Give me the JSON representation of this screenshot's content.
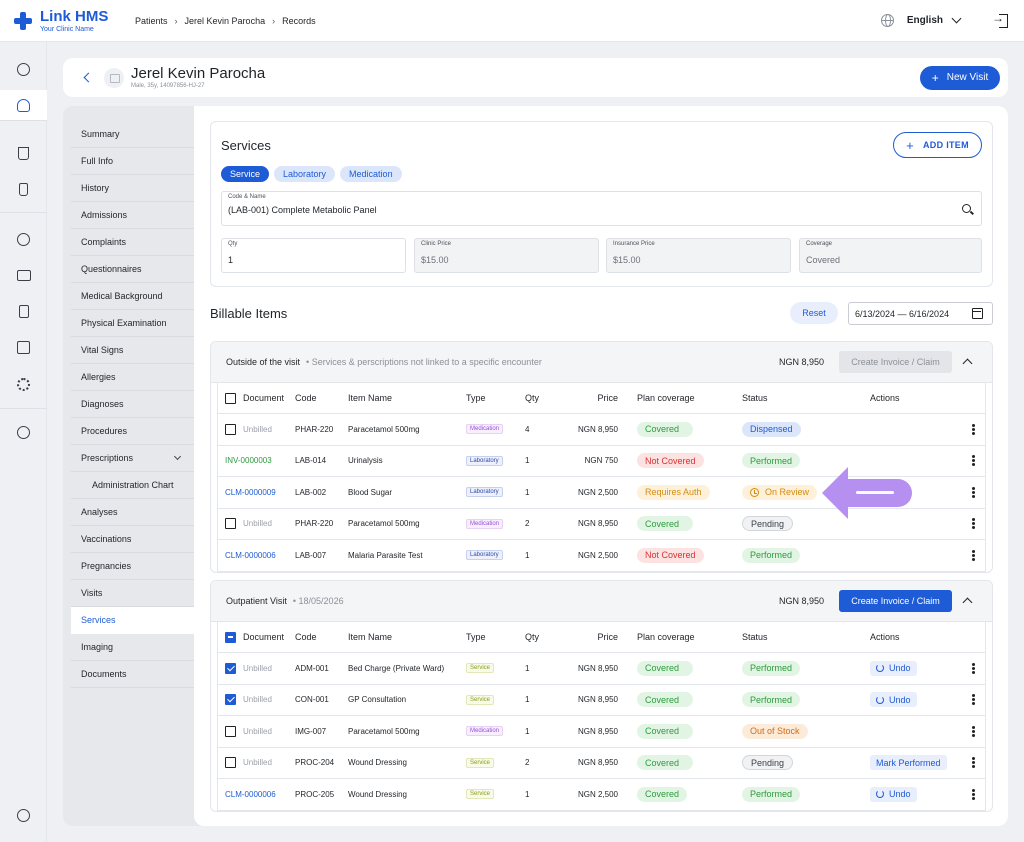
{
  "app": {
    "logo_name": "Link HMS",
    "logo_sub": "Your Clinic Name"
  },
  "breadcrumb": [
    "Patients",
    "Jerel Kevin Parocha",
    "Records"
  ],
  "language": "English",
  "patient": {
    "name": "Jerel Kevin Parocha",
    "meta": "Male, 35y, 14097856-HJ-27"
  },
  "new_visit_label": "New Visit",
  "subnav": [
    {
      "label": "Summary"
    },
    {
      "label": "Full Info"
    },
    {
      "label": "History"
    },
    {
      "label": "Admissions"
    },
    {
      "label": "Complaints"
    },
    {
      "label": "Questionnaires"
    },
    {
      "label": "Medical Background"
    },
    {
      "label": "Physical Examination"
    },
    {
      "label": "Vital Signs"
    },
    {
      "label": "Allergies"
    },
    {
      "label": "Diagnoses"
    },
    {
      "label": "Procedures"
    },
    {
      "label": "Prescriptions"
    },
    {
      "label": "Administration Chart"
    },
    {
      "label": "Analyses"
    },
    {
      "label": "Vaccinations"
    },
    {
      "label": "Pregnancies"
    },
    {
      "label": "Visits"
    },
    {
      "label": "Services"
    },
    {
      "label": "Imaging"
    },
    {
      "label": "Documents"
    }
  ],
  "services": {
    "title": "Services",
    "add_item_label": "ADD ITEM",
    "tabs": [
      "Service",
      "Laboratory",
      "Medication"
    ],
    "code_name": {
      "label": "Code & Name",
      "value": "(LAB-001) Complete Metabolic Panel"
    },
    "qty": {
      "label": "Qty",
      "value": "1"
    },
    "clinic_price": {
      "label": "Clinic Price",
      "value": "$15.00"
    },
    "insurance_price": {
      "label": "Insurance Price",
      "value": "$15.00"
    },
    "coverage": {
      "label": "Coverage",
      "value": "Covered"
    }
  },
  "billable": {
    "title": "Billable Items",
    "reset_label": "Reset",
    "date_range": "6/13/2024 — 6/16/2024"
  },
  "columns": {
    "document": "Document",
    "code": "Code",
    "item_name": "Item Name",
    "type": "Type",
    "qty": "Qty",
    "price": "Price",
    "plan": "Plan coverage",
    "status": "Status",
    "actions": "Actions"
  },
  "groups": [
    {
      "title": "Outside of the visit",
      "subtitle": "Services & perscriptions not linked to a specific encounter",
      "total": "NGN 8,950",
      "invoice_label": "Create Invoice / Claim",
      "rows": [
        {
          "doc": "Unbilled",
          "code": "PHAR-220",
          "name": "Paracetamol 500mg",
          "type": "Medication",
          "qty": "4",
          "price": "NGN 8,950",
          "plan": "Covered",
          "status": "Dispensed",
          "action": ""
        },
        {
          "doc": "INV-0000003",
          "code": "LAB-014",
          "name": "Urinalysis",
          "type": "Laboratory",
          "qty": "1",
          "price": "NGN 750",
          "plan": "Not Covered",
          "status": "Performed",
          "action": ""
        },
        {
          "doc": "CLM-0000009",
          "code": "LAB-002",
          "name": "Blood Sugar",
          "type": "Laboratory",
          "qty": "1",
          "price": "NGN 2,500",
          "plan": "Requires Auth",
          "status": "On Review",
          "action": ""
        },
        {
          "doc": "Unbilled",
          "code": "PHAR-220",
          "name": "Paracetamol 500mg",
          "type": "Medication",
          "qty": "2",
          "price": "NGN 8,950",
          "plan": "Covered",
          "status": "Pending",
          "action": ""
        },
        {
          "doc": "CLM-0000006",
          "code": "LAB-007",
          "name": "Malaria Parasite Test",
          "type": "Laboratory",
          "qty": "1",
          "price": "NGN 2,500",
          "plan": "Not Covered",
          "status": "Performed",
          "action": ""
        }
      ]
    },
    {
      "title": "Outpatient Visit",
      "subtitle": "18/05/2026",
      "total": "NGN 8,950",
      "invoice_label": "Create Invoice / Claim",
      "rows": [
        {
          "doc": "Unbilled",
          "code": "ADM-001",
          "name": "Bed Charge (Private Ward)",
          "type": "Service",
          "qty": "1",
          "price": "NGN 8,950",
          "plan": "Covered",
          "status": "Performed",
          "action": "Undo"
        },
        {
          "doc": "Unbilled",
          "code": "CON-001",
          "name": "GP Consultation",
          "type": "Service",
          "qty": "1",
          "price": "NGN 8,950",
          "plan": "Covered",
          "status": "Performed",
          "action": "Undo"
        },
        {
          "doc": "Unbilled",
          "code": "IMG-007",
          "name": "Paracetamol 500mg",
          "type": "Medication",
          "qty": "1",
          "price": "NGN 8,950",
          "plan": "Covered",
          "status": "Out of Stock",
          "action": ""
        },
        {
          "doc": "Unbilled",
          "code": "PROC-204",
          "name": "Wound Dressing",
          "type": "Service",
          "qty": "2",
          "price": "NGN 8,950",
          "plan": "Covered",
          "status": "Pending",
          "action": "Mark Performed"
        },
        {
          "doc": "CLM-0000006",
          "code": "PROC-205",
          "name": "Wound Dressing",
          "type": "Service",
          "qty": "1",
          "price": "NGN 2,500",
          "plan": "Covered",
          "status": "Performed",
          "action": "Undo"
        }
      ]
    }
  ],
  "colors": {
    "accent": "#1e5bd6",
    "success": "#2e9a3c",
    "danger": "#d63333",
    "warning": "#d78a12",
    "annotation": "#b690f0"
  }
}
